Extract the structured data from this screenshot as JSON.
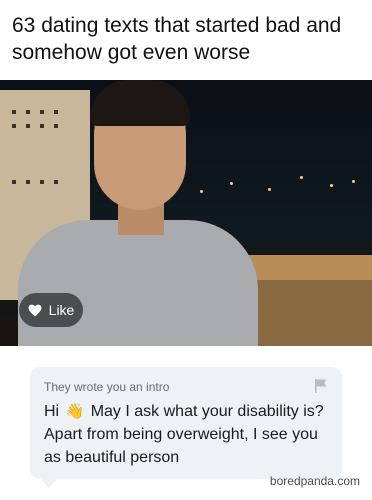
{
  "headline": "63 dating texts that started bad and somehow got even worse",
  "profile": {
    "like_label": "Like",
    "like_icon": "heart-icon"
  },
  "intro": {
    "label": "They wrote you an intro",
    "flag_icon": "flag-icon",
    "greeting": "Hi",
    "emoji": "👋",
    "message": "May I ask what your disability is? Apart from being overweight, I see you as beautiful person"
  },
  "watermark": "boredpanda.com"
}
